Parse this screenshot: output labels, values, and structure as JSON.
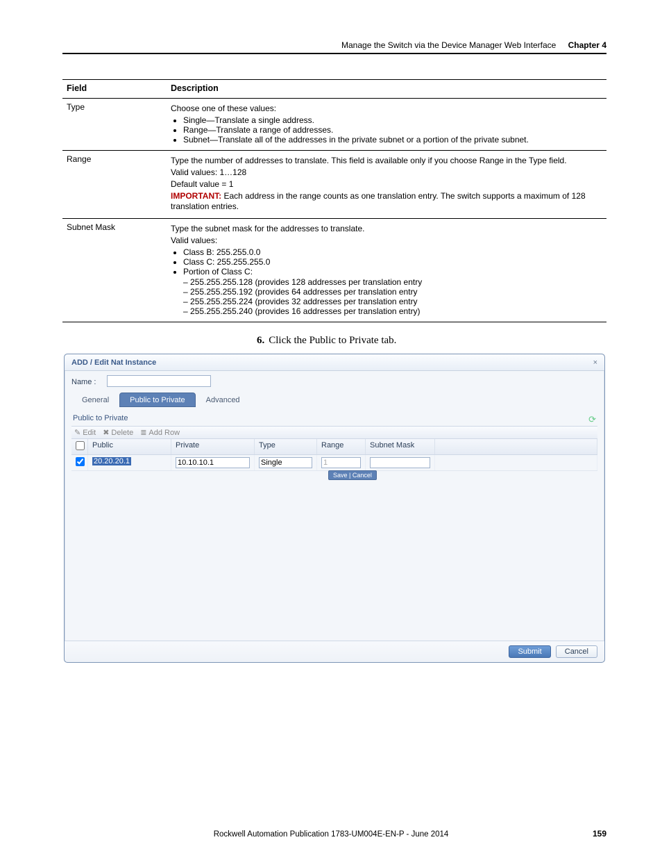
{
  "header": {
    "title": "Manage the Switch via the Device Manager Web Interface",
    "chapter": "Chapter 4"
  },
  "table": {
    "col_field": "Field",
    "col_desc": "Description",
    "rows": [
      {
        "field": "Type",
        "intro": "Choose one of these values:",
        "bullets": [
          "Single—Translate a single address.",
          "Range—Translate a range of addresses.",
          "Subnet—Translate all of the addresses in the private subnet or a portion of the private subnet."
        ]
      },
      {
        "field": "Range",
        "lines": [
          "Type the number of addresses to translate. This field is available only if you choose Range in the Type field.",
          "Valid values: 1…128",
          "Default value = 1"
        ],
        "important_label": "IMPORTANT:",
        "important_text": " Each address in the range counts as one translation entry. The switch supports a maximum of 128 translation entries."
      },
      {
        "field": "Subnet Mask",
        "lines": [
          "Type the subnet mask for the addresses to translate.",
          "Valid values:"
        ],
        "bullets": [
          "Class B: 255.255.0.0",
          "Class C: 255.255.255.0",
          "Portion of Class C:"
        ],
        "sub": [
          "255.255.255.128 (provides 128 addresses per translation entry",
          "255.255.255.192 (provides 64 addresses per translation entry",
          "255.255.255.224 (provides 32 addresses per translation entry",
          "255.255.255.240 (provides 16 addresses per translation entry)"
        ]
      }
    ]
  },
  "step": {
    "num": "6.",
    "text": "Click the Public to Private tab."
  },
  "dialog": {
    "title": "ADD / Edit Nat Instance",
    "close": "×",
    "name_label": "Name :",
    "tabs": {
      "general": "General",
      "p2p": "Public to Private",
      "advanced": "Advanced"
    },
    "section": "Public to Private",
    "toolbar": {
      "edit": "Edit",
      "delete": "Delete",
      "add": "Add Row"
    },
    "columns": {
      "public": "Public",
      "private": "Private",
      "type": "Type",
      "range": "Range",
      "subnet": "Subnet Mask"
    },
    "row": {
      "public": "20.20.20.1",
      "private": "10.10.10.1",
      "type": "Single",
      "range": "1",
      "subnet": ""
    },
    "inline": "Save | Cancel",
    "submit": "Submit",
    "cancel": "Cancel"
  },
  "footer": {
    "pub": "Rockwell Automation Publication 1783-UM004E-EN-P - June 2014",
    "page": "159"
  }
}
